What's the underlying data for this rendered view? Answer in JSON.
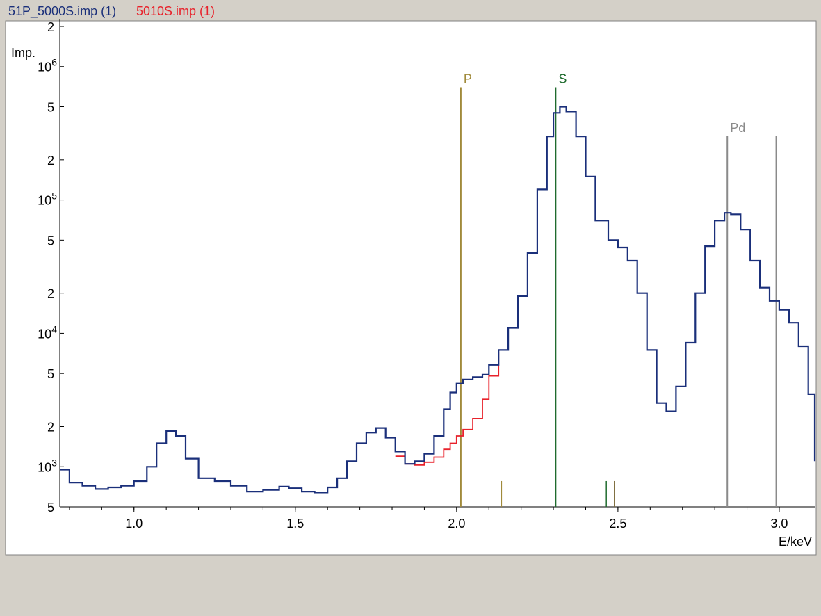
{
  "window": {
    "tabs": [
      {
        "label": "51P_5000S.imp (1)",
        "color": "#1a2f7a"
      },
      {
        "label": "5010S.imp (1)",
        "color": "#e8222b"
      }
    ]
  },
  "chart_data": {
    "type": "line",
    "ylabel": "Imp.",
    "xlabel": "E/keV",
    "xlim": [
      0.77,
      3.11
    ],
    "ylim": [
      500,
      2000000
    ],
    "yscale": "log",
    "grid": false,
    "x_ticks": [
      "1.0",
      "1.5",
      "2.0",
      "2.5",
      "3.0"
    ],
    "y_ticks": [
      {
        "value": 500,
        "label": "5"
      },
      {
        "value": 1000,
        "label": "10",
        "exp": "3"
      },
      {
        "value": 2000,
        "label": "2"
      },
      {
        "value": 5000,
        "label": "5"
      },
      {
        "value": 10000,
        "label": "10",
        "exp": "4"
      },
      {
        "value": 20000,
        "label": "2"
      },
      {
        "value": 50000,
        "label": "5"
      },
      {
        "value": 100000,
        "label": "10",
        "exp": "5"
      },
      {
        "value": 200000,
        "label": "2"
      },
      {
        "value": 500000,
        "label": "5"
      },
      {
        "value": 1000000,
        "label": "10",
        "exp": "6"
      },
      {
        "value": 2000000,
        "label": "2"
      }
    ],
    "element_markers": [
      {
        "label": "P",
        "color": "#a08a3a",
        "lines": [
          {
            "x": 2.013,
            "top": 700000
          },
          {
            "x": 2.139,
            "top": 780
          }
        ]
      },
      {
        "label": "S",
        "color": "#1f6b2e",
        "lines": [
          {
            "x": 2.307,
            "top": 700000
          },
          {
            "x": 2.464,
            "top": 780
          }
        ]
      },
      {
        "label": "Pd",
        "color": "#8a8a8a",
        "lines": [
          {
            "x": 2.839,
            "top": 300000
          },
          {
            "x": 2.99,
            "top": 300000
          }
        ]
      },
      {
        "label": "",
        "color": "#7a6a3a",
        "lines": [
          {
            "x": 2.489,
            "top": 780
          }
        ]
      }
    ],
    "series": [
      {
        "name": "51P_5000S.imp (1)",
        "color": "#1a2f7a",
        "x": [
          0.77,
          0.8,
          0.84,
          0.88,
          0.92,
          0.96,
          1.0,
          1.04,
          1.07,
          1.1,
          1.13,
          1.16,
          1.2,
          1.25,
          1.3,
          1.35,
          1.4,
          1.45,
          1.48,
          1.52,
          1.56,
          1.6,
          1.63,
          1.66,
          1.69,
          1.72,
          1.75,
          1.78,
          1.81,
          1.84,
          1.87,
          1.9,
          1.93,
          1.96,
          1.98,
          2.0,
          2.02,
          2.05,
          2.08,
          2.1,
          2.13,
          2.16,
          2.19,
          2.22,
          2.25,
          2.28,
          2.3,
          2.32,
          2.34,
          2.37,
          2.4,
          2.43,
          2.47,
          2.5,
          2.53,
          2.56,
          2.59,
          2.62,
          2.65,
          2.68,
          2.71,
          2.74,
          2.77,
          2.8,
          2.83,
          2.85,
          2.88,
          2.91,
          2.94,
          2.97,
          3.0,
          3.03,
          3.06,
          3.09,
          3.11
        ],
        "values": [
          950,
          760,
          720,
          680,
          700,
          720,
          780,
          1000,
          1500,
          1850,
          1700,
          1150,
          820,
          780,
          720,
          650,
          670,
          710,
          690,
          650,
          640,
          700,
          820,
          1100,
          1500,
          1800,
          1950,
          1650,
          1300,
          1050,
          1100,
          1250,
          1700,
          2700,
          3600,
          4200,
          4500,
          4700,
          4900,
          5800,
          7500,
          11000,
          19000,
          40000,
          120000,
          300000,
          450000,
          500000,
          460000,
          300000,
          150000,
          70000,
          50000,
          44000,
          35000,
          20000,
          7500,
          3000,
          2600,
          4000,
          8500,
          20000,
          45000,
          70000,
          80000,
          78000,
          60000,
          35000,
          22000,
          17500,
          15000,
          12000,
          8000,
          3500,
          1100
        ]
      },
      {
        "name": "5010S.imp (1)",
        "color": "#e8222b",
        "x": [
          1.81,
          1.84,
          1.87,
          1.9,
          1.93,
          1.96,
          1.98,
          2.0,
          2.02,
          2.05,
          2.08,
          2.1,
          2.13
        ],
        "values": [
          1200,
          1050,
          1030,
          1080,
          1180,
          1350,
          1500,
          1700,
          1900,
          2300,
          3200,
          4800,
          7200
        ]
      }
    ]
  }
}
